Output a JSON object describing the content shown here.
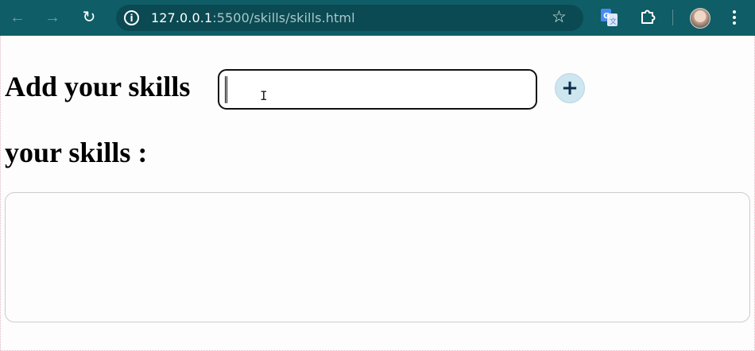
{
  "browser": {
    "url_host": "127.0.0.1",
    "url_path": ":5500/skills/skills.html"
  },
  "icons": {
    "back": "arrow-left-icon",
    "forward": "arrow-right-icon",
    "reload": "reload-icon",
    "site_info": "info-icon",
    "bookmark": "star-icon",
    "translate": "google-translate-icon",
    "extensions": "puzzle-icon",
    "profile": "avatar",
    "menu": "kebab-menu-icon",
    "add": "plus-icon"
  },
  "colors": {
    "toolbar": "#0f5d66",
    "omnibox": "#0b4a52",
    "add_button_bg": "#cde6ef",
    "add_button_fg": "#0c2c4a"
  },
  "page": {
    "add_heading": "Add your skills",
    "skill_input_value": "",
    "add_button_label": "+",
    "skills_heading": "your skills :"
  }
}
